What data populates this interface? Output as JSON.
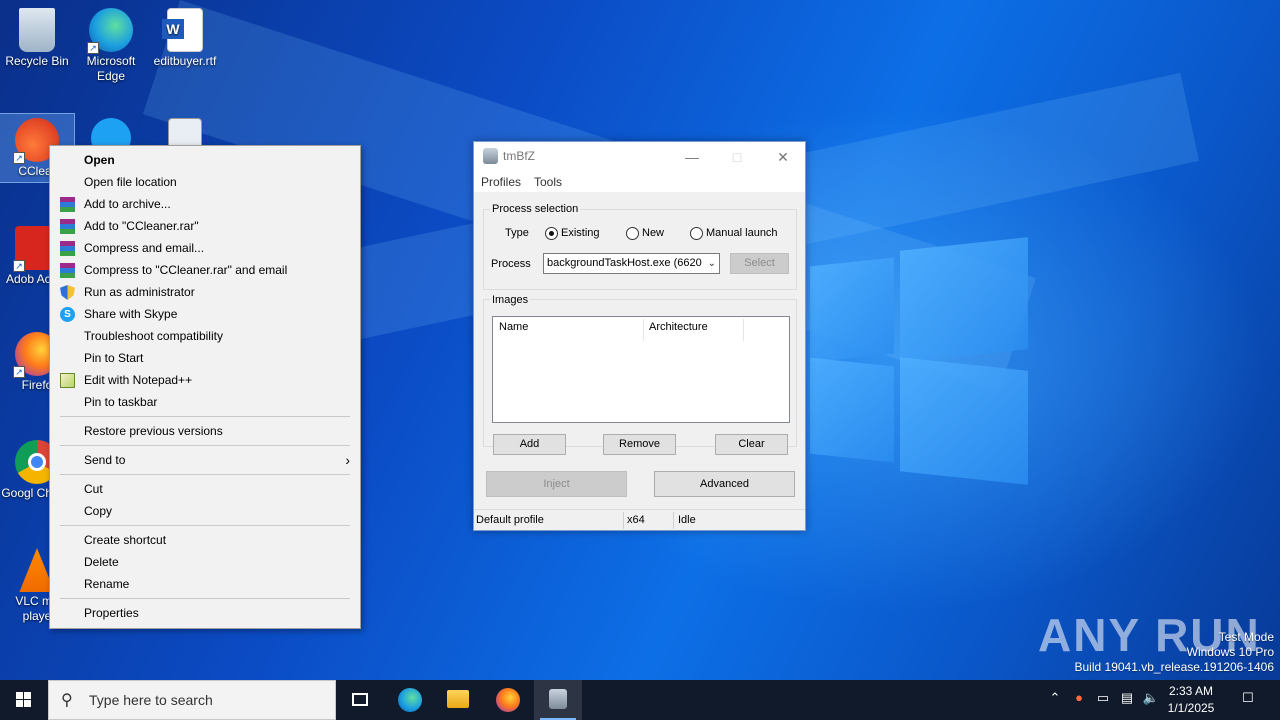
{
  "desktop": {
    "icons": [
      {
        "label": "Recycle Bin"
      },
      {
        "label": "Microsoft Edge"
      },
      {
        "label": "editbuyer.rtf"
      },
      {
        "label": "CClear"
      },
      {
        "label": "Adob Acrob"
      },
      {
        "label": "Firefo"
      },
      {
        "label": "Googl Chrom"
      },
      {
        "label": "VLC me playe"
      }
    ]
  },
  "context_menu": {
    "items": [
      {
        "label": "Open"
      },
      {
        "label": "Open file location"
      },
      {
        "label": "Add to archive..."
      },
      {
        "label": "Add to \"CCleaner.rar\""
      },
      {
        "label": "Compress and email..."
      },
      {
        "label": "Compress to \"CCleaner.rar\" and email"
      },
      {
        "label": "Run as administrator"
      },
      {
        "label": "Share with Skype"
      },
      {
        "label": "Troubleshoot compatibility"
      },
      {
        "label": "Pin to Start"
      },
      {
        "label": "Edit with Notepad++"
      },
      {
        "label": "Pin to taskbar"
      },
      {
        "label": "Restore previous versions"
      },
      {
        "label": "Send to"
      },
      {
        "label": "Cut"
      },
      {
        "label": "Copy"
      },
      {
        "label": "Create shortcut"
      },
      {
        "label": "Delete"
      },
      {
        "label": "Rename"
      },
      {
        "label": "Properties"
      }
    ]
  },
  "dialog": {
    "title": "tmBfZ",
    "menu": {
      "profiles": "Profiles",
      "tools": "Tools"
    },
    "process_selection": {
      "group_label": "Process selection",
      "type_label": "Type",
      "radios": {
        "existing": "Existing",
        "new": "New",
        "manual": "Manual launch"
      },
      "selected": "Existing",
      "process_label": "Process",
      "process_value": "backgroundTaskHost.exe (6620",
      "select_button": "Select"
    },
    "images": {
      "group_label": "Images",
      "col_name": "Name",
      "col_arch": "Architecture",
      "add_button": "Add",
      "remove_button": "Remove",
      "clear_button": "Clear"
    },
    "inject_button": "Inject",
    "advanced_button": "Advanced",
    "status": {
      "profile": "Default profile",
      "arch": "x64",
      "state": "Idle"
    }
  },
  "watermark": {
    "brand": "ANY RUN",
    "line1": "Test Mode",
    "line2": "Windows 10 Pro",
    "line3": "Build 19041.vb_release.191206-1406"
  },
  "taskbar": {
    "search_placeholder": "Type here to search",
    "time": "2:33 AM",
    "date": "1/1/2025"
  },
  "colors": {
    "accent": "#0078d7",
    "taskbar": "#101a2b",
    "menu_bg": "#f2f2f2"
  }
}
